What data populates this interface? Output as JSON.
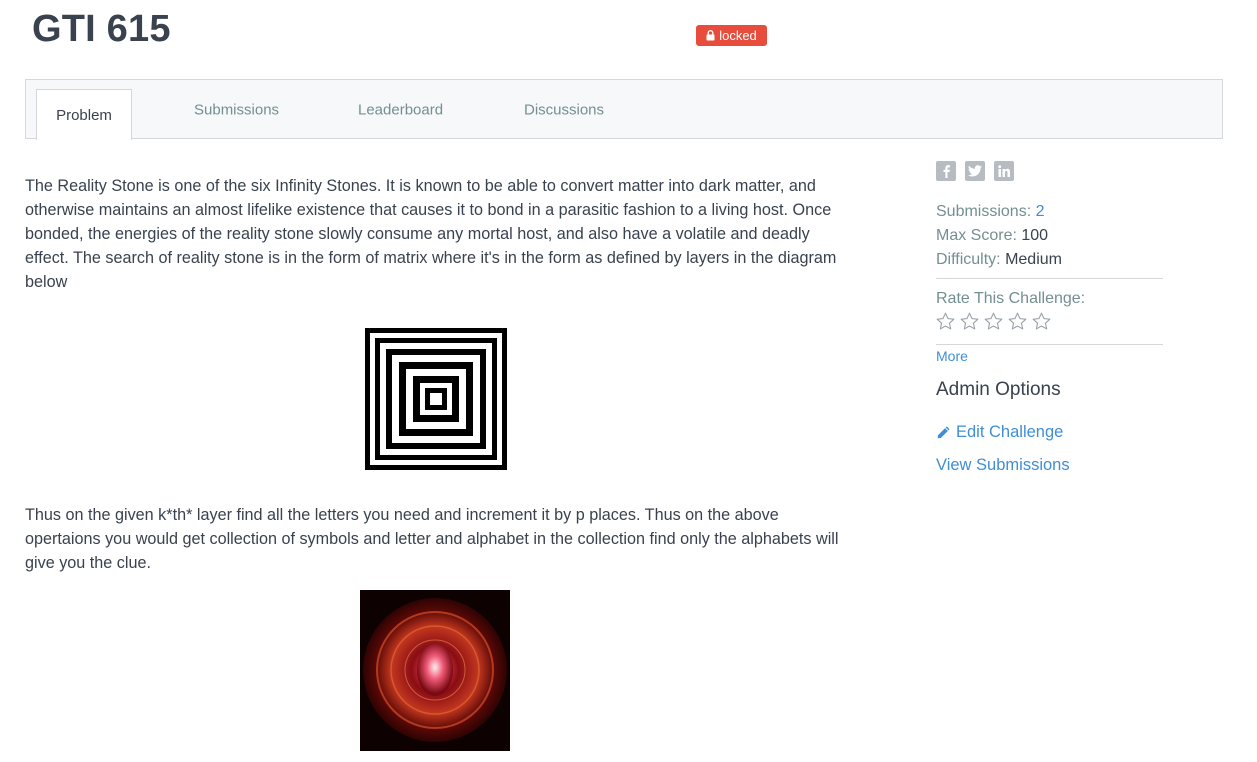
{
  "header": {
    "title": "GTI 615",
    "badge": "locked",
    "badge_color": "#e74c3c"
  },
  "tabs": [
    {
      "label": "Problem",
      "active": true
    },
    {
      "label": "Submissions",
      "active": false
    },
    {
      "label": "Leaderboard",
      "active": false
    },
    {
      "label": "Discussions",
      "active": false
    }
  ],
  "problem": {
    "paragraph1": "The Reality Stone is one of the six Infinity Stones. It is known to be able to convert matter into dark matter, and otherwise maintains an almost lifelike existence that causes it to bond in a parasitic fashion to a living host. Once bonded, the energies of the reality stone slowly consume any mortal host, and also have a volatile and deadly effect. The search of reality stone is in the form of matrix where it's in the form as defined by layers in the diagram below",
    "paragraph2": "Thus on the given k*th* layer find all the letters you need and increment it by p places. Thus on the above opertaions you would get collection of symbols and letter and alphabet in the collection find only the alphabets will give you the clue.",
    "figure1": "concentric-squares-diagram",
    "figure2": "reality-stone-image"
  },
  "sidebar": {
    "share_icons": [
      "facebook-icon",
      "twitter-icon",
      "linkedin-icon"
    ],
    "submissions_label": "Submissions:",
    "submissions_value": "2",
    "max_score_label": "Max Score:",
    "max_score_value": "100",
    "difficulty_label": "Difficulty:",
    "difficulty_value": "Medium",
    "rate_label": "Rate This Challenge:",
    "rating": 0,
    "rating_max": 5,
    "more_label": "More",
    "admin_title": "Admin Options",
    "edit_label": "Edit Challenge",
    "view_label": "View Submissions"
  },
  "colors": {
    "text": "#39424e",
    "muted": "#738f93",
    "link": "#3f8ed8",
    "border": "#d5d7da"
  }
}
